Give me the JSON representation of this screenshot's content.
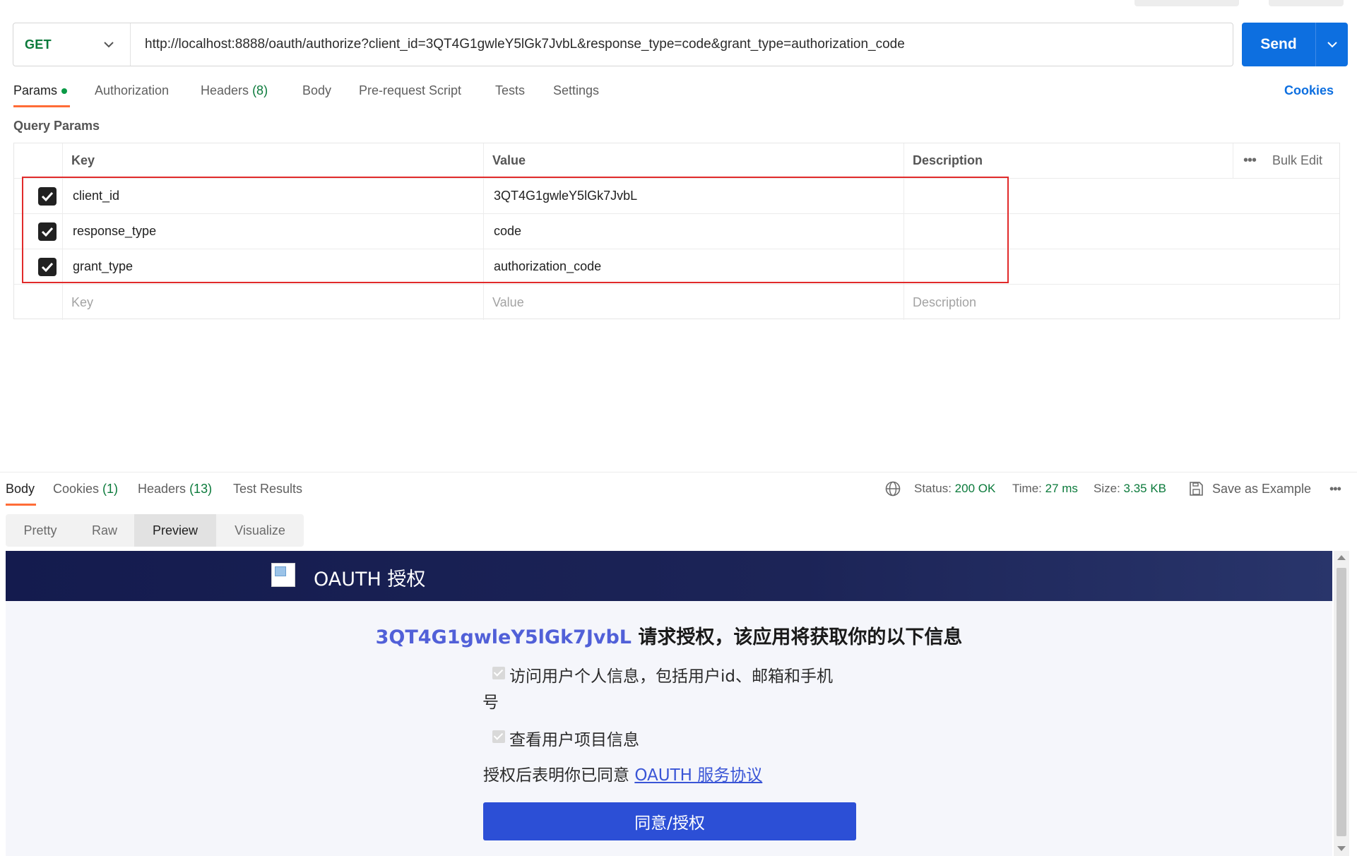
{
  "request": {
    "method": "GET",
    "url": "http://localhost:8888/oauth/authorize?client_id=3QT4G1gwleY5lGk7JvbL&response_type=code&grant_type=authorization_code",
    "send_label": "Send"
  },
  "req_tabs": {
    "params": "Params",
    "authorization": "Authorization",
    "headers": "Headers",
    "headers_count": "(8)",
    "body": "Body",
    "pre_request": "Pre-request Script",
    "tests": "Tests",
    "settings": "Settings",
    "cookies": "Cookies"
  },
  "params": {
    "section_title": "Query Params",
    "columns": {
      "key": "Key",
      "value": "Value",
      "description": "Description",
      "bulk_edit": "Bulk Edit"
    },
    "rows": [
      {
        "key": "client_id",
        "value": "3QT4G1gwleY5lGk7JvbL",
        "description": "",
        "checked": true
      },
      {
        "key": "response_type",
        "value": "code",
        "description": "",
        "checked": true
      },
      {
        "key": "grant_type",
        "value": "authorization_code",
        "description": "",
        "checked": true
      }
    ],
    "placeholder": {
      "key": "Key",
      "value": "Value",
      "description": "Description"
    }
  },
  "response": {
    "tabs": {
      "body": "Body",
      "cookies": "Cookies",
      "cookies_count": "(1)",
      "headers": "Headers",
      "headers_count": "(13)",
      "test_results": "Test Results"
    },
    "status_label": "Status:",
    "status_value": "200 OK",
    "time_label": "Time:",
    "time_value": "27 ms",
    "size_label": "Size:",
    "size_value": "3.35 KB",
    "save_example": "Save as Example",
    "views": [
      "Pretty",
      "Raw",
      "Preview",
      "Visualize"
    ],
    "active_view": "Preview"
  },
  "preview": {
    "title": "OAUTH 授权",
    "app_id": "3QT4G1gwleY5lGk7JvbL",
    "request_text": " 请求授权，该应用将获取你的以下信息",
    "perm1_line1": "访问用户个人信息，包括用户id、邮箱和手机",
    "perm1_line2": "号",
    "perm2": "查看用户项目信息",
    "agree_prefix": "授权后表明你已同意 ",
    "agree_link": "OAUTH 服务协议",
    "authorize_button": "同意/授权"
  },
  "colors": {
    "accent": "#0d6fe0",
    "success": "#0b7a3b",
    "tab_underline": "#ff6c37",
    "highlight": "#e12a2a",
    "preview_header": "#1c2457",
    "authorize_button": "#2c4fd6"
  }
}
